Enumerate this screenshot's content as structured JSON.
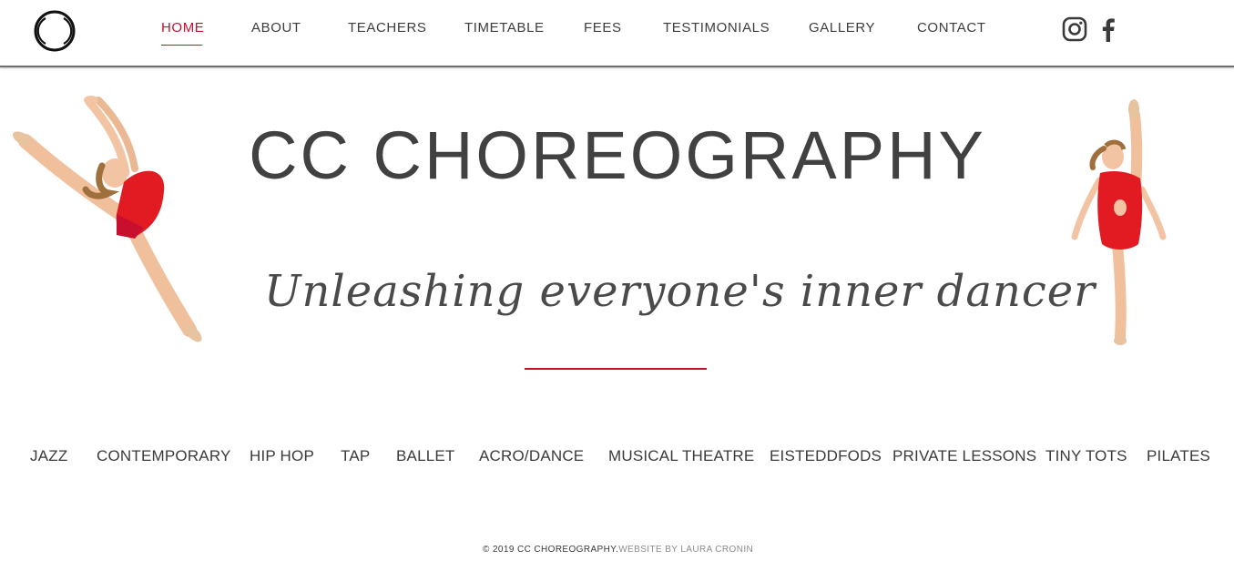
{
  "header": {
    "logo_icon": "circle-logo-icon",
    "nav": [
      {
        "label": "HOME",
        "active": true
      },
      {
        "label": "ABOUT"
      },
      {
        "label": "TEACHERS"
      },
      {
        "label": "TIMETABLE"
      },
      {
        "label": "FEES"
      },
      {
        "label": "TESTIMONIALS"
      },
      {
        "label": "GALLERY"
      },
      {
        "label": "CONTACT"
      }
    ],
    "social": [
      "instagram-icon",
      "facebook-icon"
    ]
  },
  "hero": {
    "title": "CC CHOREOGRAPHY",
    "tagline": "Unleashing everyone's inner dancer"
  },
  "classes": [
    "JAZZ",
    "CONTEMPORARY",
    "HIP HOP",
    "TAP",
    "BALLET",
    "ACRO/DANCE",
    "MUSICAL THEATRE",
    "EISTEDDFODS",
    "PRIVATE LESSONS",
    "TINY TOTS",
    "PILATES"
  ],
  "footer": {
    "copyright": "© 2019 CC CHOREOGRAPHY.",
    "credit": "WEBSITE BY LAURA CRONIN"
  },
  "colors": {
    "accent": "#c8102e",
    "text": "#3d3d3d",
    "leotard": "#e21b23"
  }
}
